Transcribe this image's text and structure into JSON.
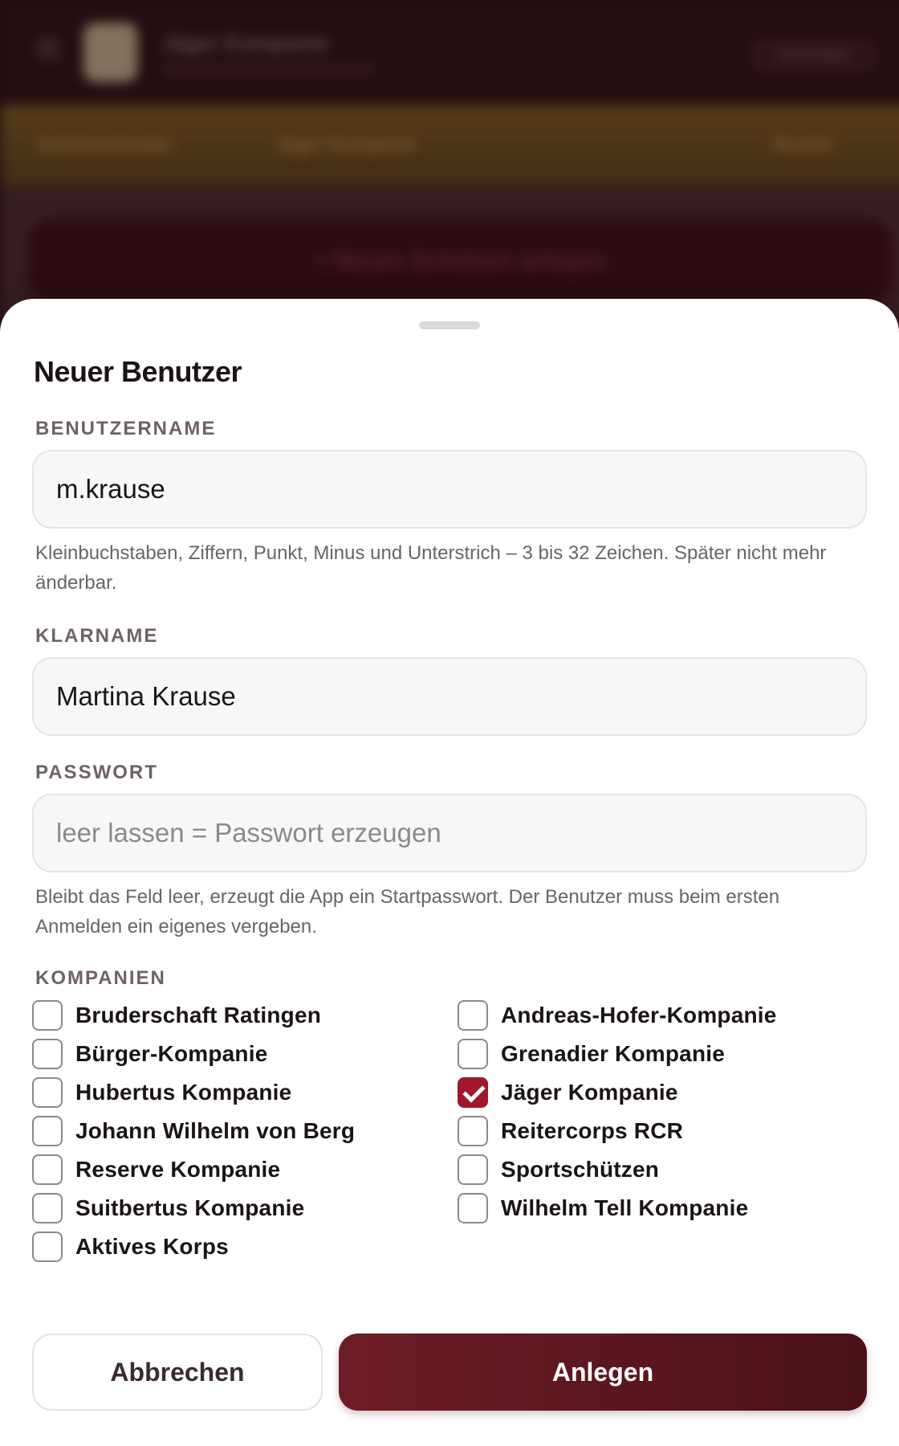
{
  "background": {
    "app_title": "Jäger Kompanie",
    "header_button": "Abmelden",
    "tabs": [
      "Schützenbrüder",
      "Jäger Kompanie",
      "Rechte"
    ],
    "new_button": "+ Neuen Schützen anlegen"
  },
  "dialog": {
    "title": "Neuer Benutzer",
    "username": {
      "label": "BENUTZERNAME",
      "value": "m.krause",
      "hint": "Kleinbuchstaben, Ziffern, Punkt, Minus und Unterstrich – 3 bis 32 Zeichen. Später nicht mehr änderbar."
    },
    "fullname": {
      "label": "KLARNAME",
      "value": "Martina Krause"
    },
    "password": {
      "label": "PASSWORT",
      "value": "",
      "placeholder": "leer lassen = Passwort erzeugen",
      "hint": "Bleibt das Feld leer, erzeugt die App ein Startpasswort. Der Benutzer muss beim ersten Anmelden ein eigenes vergeben."
    },
    "companies": {
      "label": "KOMPANIEN",
      "left": [
        {
          "name": "Bruderschaft Ratingen",
          "checked": false
        },
        {
          "name": "Bürger-Kompanie",
          "checked": false
        },
        {
          "name": "Hubertus Kompanie",
          "checked": false
        },
        {
          "name": "Johann Wilhelm von Berg",
          "checked": false
        },
        {
          "name": "Reserve Kompanie",
          "checked": false
        },
        {
          "name": "Suitbertus Kompanie",
          "checked": false
        },
        {
          "name": "Aktives Korps",
          "checked": false
        }
      ],
      "right": [
        {
          "name": "Andreas-Hofer-Kompanie",
          "checked": false
        },
        {
          "name": "Grenadier Kompanie",
          "checked": false
        },
        {
          "name": "Jäger Kompanie",
          "checked": true
        },
        {
          "name": "Reitercorps RCR",
          "checked": false
        },
        {
          "name": "Sportschützen",
          "checked": false
        },
        {
          "name": "Wilhelm Tell Kompanie",
          "checked": false
        }
      ]
    },
    "cancel_label": "Abbrechen",
    "submit_label": "Anlegen"
  },
  "colors": {
    "accent": "#a0182a",
    "primary_button": "#5e1720",
    "sheet_background": "#ffffff"
  }
}
